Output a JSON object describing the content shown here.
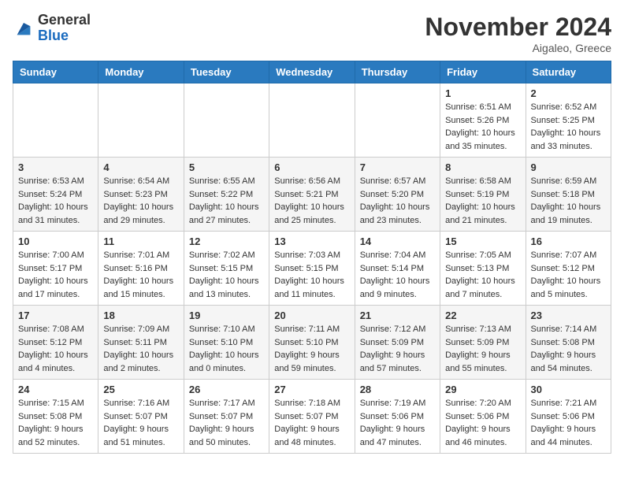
{
  "header": {
    "logo_general": "General",
    "logo_blue": "Blue",
    "month_title": "November 2024",
    "location": "Aigaleo, Greece"
  },
  "weekdays": [
    "Sunday",
    "Monday",
    "Tuesday",
    "Wednesday",
    "Thursday",
    "Friday",
    "Saturday"
  ],
  "weeks": [
    [
      {
        "day": "",
        "info": ""
      },
      {
        "day": "",
        "info": ""
      },
      {
        "day": "",
        "info": ""
      },
      {
        "day": "",
        "info": ""
      },
      {
        "day": "",
        "info": ""
      },
      {
        "day": "1",
        "info": "Sunrise: 6:51 AM\nSunset: 5:26 PM\nDaylight: 10 hours and 35 minutes."
      },
      {
        "day": "2",
        "info": "Sunrise: 6:52 AM\nSunset: 5:25 PM\nDaylight: 10 hours and 33 minutes."
      }
    ],
    [
      {
        "day": "3",
        "info": "Sunrise: 6:53 AM\nSunset: 5:24 PM\nDaylight: 10 hours and 31 minutes."
      },
      {
        "day": "4",
        "info": "Sunrise: 6:54 AM\nSunset: 5:23 PM\nDaylight: 10 hours and 29 minutes."
      },
      {
        "day": "5",
        "info": "Sunrise: 6:55 AM\nSunset: 5:22 PM\nDaylight: 10 hours and 27 minutes."
      },
      {
        "day": "6",
        "info": "Sunrise: 6:56 AM\nSunset: 5:21 PM\nDaylight: 10 hours and 25 minutes."
      },
      {
        "day": "7",
        "info": "Sunrise: 6:57 AM\nSunset: 5:20 PM\nDaylight: 10 hours and 23 minutes."
      },
      {
        "day": "8",
        "info": "Sunrise: 6:58 AM\nSunset: 5:19 PM\nDaylight: 10 hours and 21 minutes."
      },
      {
        "day": "9",
        "info": "Sunrise: 6:59 AM\nSunset: 5:18 PM\nDaylight: 10 hours and 19 minutes."
      }
    ],
    [
      {
        "day": "10",
        "info": "Sunrise: 7:00 AM\nSunset: 5:17 PM\nDaylight: 10 hours and 17 minutes."
      },
      {
        "day": "11",
        "info": "Sunrise: 7:01 AM\nSunset: 5:16 PM\nDaylight: 10 hours and 15 minutes."
      },
      {
        "day": "12",
        "info": "Sunrise: 7:02 AM\nSunset: 5:15 PM\nDaylight: 10 hours and 13 minutes."
      },
      {
        "day": "13",
        "info": "Sunrise: 7:03 AM\nSunset: 5:15 PM\nDaylight: 10 hours and 11 minutes."
      },
      {
        "day": "14",
        "info": "Sunrise: 7:04 AM\nSunset: 5:14 PM\nDaylight: 10 hours and 9 minutes."
      },
      {
        "day": "15",
        "info": "Sunrise: 7:05 AM\nSunset: 5:13 PM\nDaylight: 10 hours and 7 minutes."
      },
      {
        "day": "16",
        "info": "Sunrise: 7:07 AM\nSunset: 5:12 PM\nDaylight: 10 hours and 5 minutes."
      }
    ],
    [
      {
        "day": "17",
        "info": "Sunrise: 7:08 AM\nSunset: 5:12 PM\nDaylight: 10 hours and 4 minutes."
      },
      {
        "day": "18",
        "info": "Sunrise: 7:09 AM\nSunset: 5:11 PM\nDaylight: 10 hours and 2 minutes."
      },
      {
        "day": "19",
        "info": "Sunrise: 7:10 AM\nSunset: 5:10 PM\nDaylight: 10 hours and 0 minutes."
      },
      {
        "day": "20",
        "info": "Sunrise: 7:11 AM\nSunset: 5:10 PM\nDaylight: 9 hours and 59 minutes."
      },
      {
        "day": "21",
        "info": "Sunrise: 7:12 AM\nSunset: 5:09 PM\nDaylight: 9 hours and 57 minutes."
      },
      {
        "day": "22",
        "info": "Sunrise: 7:13 AM\nSunset: 5:09 PM\nDaylight: 9 hours and 55 minutes."
      },
      {
        "day": "23",
        "info": "Sunrise: 7:14 AM\nSunset: 5:08 PM\nDaylight: 9 hours and 54 minutes."
      }
    ],
    [
      {
        "day": "24",
        "info": "Sunrise: 7:15 AM\nSunset: 5:08 PM\nDaylight: 9 hours and 52 minutes."
      },
      {
        "day": "25",
        "info": "Sunrise: 7:16 AM\nSunset: 5:07 PM\nDaylight: 9 hours and 51 minutes."
      },
      {
        "day": "26",
        "info": "Sunrise: 7:17 AM\nSunset: 5:07 PM\nDaylight: 9 hours and 50 minutes."
      },
      {
        "day": "27",
        "info": "Sunrise: 7:18 AM\nSunset: 5:07 PM\nDaylight: 9 hours and 48 minutes."
      },
      {
        "day": "28",
        "info": "Sunrise: 7:19 AM\nSunset: 5:06 PM\nDaylight: 9 hours and 47 minutes."
      },
      {
        "day": "29",
        "info": "Sunrise: 7:20 AM\nSunset: 5:06 PM\nDaylight: 9 hours and 46 minutes."
      },
      {
        "day": "30",
        "info": "Sunrise: 7:21 AM\nSunset: 5:06 PM\nDaylight: 9 hours and 44 minutes."
      }
    ]
  ]
}
